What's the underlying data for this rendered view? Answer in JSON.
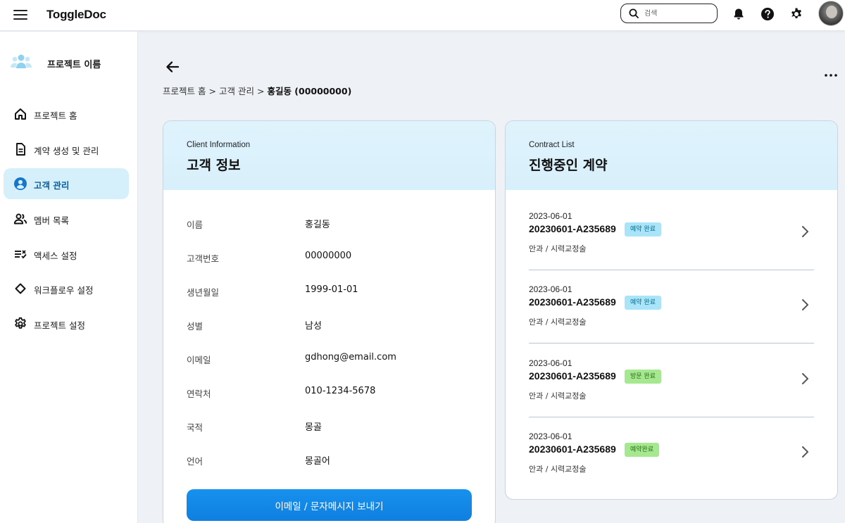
{
  "app": {
    "name": "ToggleDoc"
  },
  "search": {
    "placeholder": "검색"
  },
  "sidebar": {
    "project_name": "프로젝트 이름",
    "items": [
      {
        "label": "프로젝트 홈",
        "icon": "home-icon"
      },
      {
        "label": "계약 생성 및 관리",
        "icon": "document-icon"
      },
      {
        "label": "고객 관리",
        "icon": "user-circle-icon",
        "active": true
      },
      {
        "label": "멤버 목록",
        "icon": "members-icon"
      },
      {
        "label": "액세스 설정",
        "icon": "access-list-icon"
      },
      {
        "label": "워크플로우 설정",
        "icon": "diamond-icon"
      },
      {
        "label": "프로젝트 설정",
        "icon": "gear-icon"
      }
    ]
  },
  "breadcrumb": {
    "items": [
      "프로젝트 홈",
      "고객 관리"
    ],
    "separator": ">",
    "current": "홍길동 (00000000)"
  },
  "client_card": {
    "subtitle": "Client Information",
    "title": "고객 정보",
    "fields": [
      {
        "label": "이름",
        "value": "홍길동"
      },
      {
        "label": "고객번호",
        "value": "00000000"
      },
      {
        "label": "생년월일",
        "value": "1999-01-01"
      },
      {
        "label": "성별",
        "value": "남성"
      },
      {
        "label": "이메일",
        "value": "gdhong@email.com"
      },
      {
        "label": "연락처",
        "value": "010-1234-5678"
      },
      {
        "label": "국적",
        "value": "몽골"
      },
      {
        "label": "언어",
        "value": "몽골어"
      }
    ],
    "send_button": "이메일 / 문자메시지 보내기"
  },
  "contract_card": {
    "subtitle": "Contract List",
    "title": "진행중인 계약",
    "items": [
      {
        "date": "2023-06-01",
        "id": "20230601-A235689",
        "status": "예약 완료",
        "status_color": "blue",
        "meta": "안과 / 시력교정술"
      },
      {
        "date": "2023-06-01",
        "id": "20230601-A235689",
        "status": "예약 완료",
        "status_color": "blue",
        "meta": "안과 / 시력교정술"
      },
      {
        "date": "2023-06-01",
        "id": "20230601-A235689",
        "status": "방문 완료",
        "status_color": "green",
        "meta": "안과 / 시력교정술"
      },
      {
        "date": "2023-06-01",
        "id": "20230601-A235689",
        "status": "예약완료",
        "status_color": "green",
        "meta": "안과 / 시력교정술"
      }
    ]
  },
  "colors": {
    "accent": "#0f7fe0",
    "active_nav_bg": "#d6f0fb",
    "card_header_bg": "#dff3fc",
    "badge_blue_bg": "#a9e4f8",
    "badge_blue_fg": "#0b6c8c",
    "badge_green_bg": "#a5e88f",
    "badge_green_fg": "#2a6e18"
  }
}
